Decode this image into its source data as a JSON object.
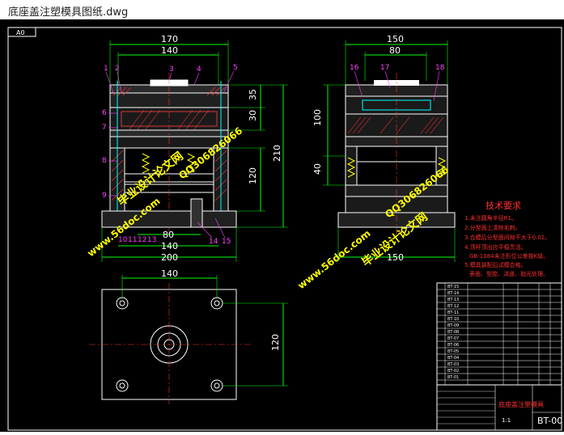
{
  "window": {
    "title": "底座盖注塑模具图纸.dwg"
  },
  "drawing": {
    "sheet_tag": "A0",
    "dims": {
      "front_w170": "170",
      "front_w140": "140",
      "front_b80": "80",
      "front_b140": "140",
      "front_b200": "200",
      "front_h35": "35",
      "front_h30": "30",
      "front_h120": "120",
      "front_h210": "210",
      "side_w150": "150",
      "side_w80": "80",
      "side_b150": "150",
      "side_h100": "100",
      "side_h40": "40",
      "plan_w140": "140",
      "plan_h120": "120"
    },
    "callouts": [
      "1",
      "2",
      "3",
      "4",
      "5",
      "6",
      "7",
      "8",
      "9",
      "10",
      "11",
      "12",
      "13",
      "14",
      "15",
      "16",
      "17",
      "18"
    ],
    "tech": {
      "title": "技术要求",
      "lines": [
        "1.未注圆角半径R1。",
        "2.分型面上清除毛刺。",
        "3.合模后分型面间隙不大于0.02。",
        "4.顶杆顶出应平稳灵活。",
        "GB-1184未注形位公差按K级。",
        "5.模具装配后试模合格。",
        "表面、型腔、浇道、抛光处理。"
      ]
    },
    "watermarks": {
      "site1": "www.56doc.com",
      "site2": "www.56doc.com",
      "qq1": "QQ306826066",
      "qq2": "QQ306826066",
      "brand1": "毕业设计论文网",
      "brand2": "毕业设计论文网"
    },
    "titleblock": {
      "drawing_no": "BT-00",
      "name": "底座盖注塑模具",
      "scale": "1:1"
    },
    "bom_codes": [
      "BT-15",
      "BT-14",
      "BT-13",
      "BT-12",
      "BT-11",
      "BT-10",
      "BT-09",
      "BT-08",
      "BT-07",
      "BT-06",
      "BT-05",
      "BT-04",
      "BT-03",
      "BT-02",
      "BT-01"
    ]
  }
}
